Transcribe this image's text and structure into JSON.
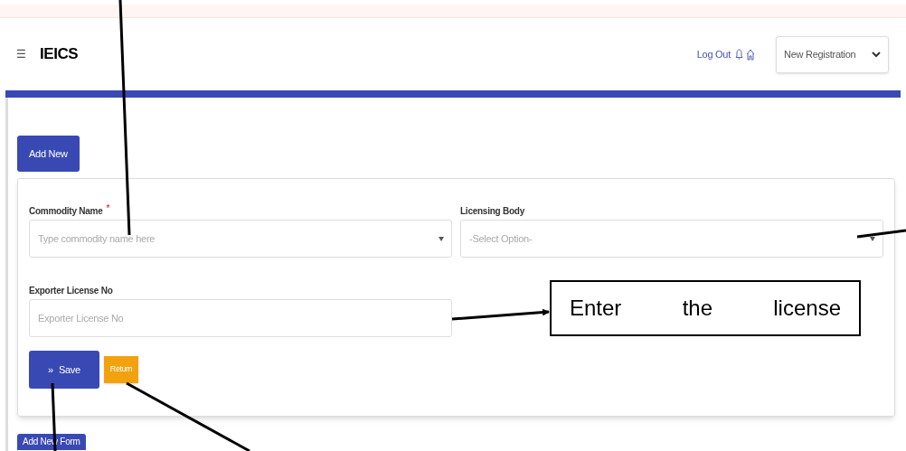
{
  "header": {
    "menu_glyph": "☰",
    "app_title": "IEICS",
    "logout_link": "Log Out",
    "registration_select": {
      "value": "New Registration"
    }
  },
  "add_new_button": "Add New",
  "form": {
    "fields": [
      {
        "label": "Commodity Name",
        "required_mark": "*",
        "kind": "combo",
        "placeholder": "Type commodity name here"
      },
      {
        "label": "Licensing Body",
        "kind": "select",
        "placeholder": "-Select Option-"
      },
      {
        "label": "Exporter License No",
        "kind": "text",
        "placeholder": "Exporter License No"
      }
    ],
    "save_button": {
      "glyph": "»",
      "label": "Save"
    },
    "return_button": "Return"
  },
  "add_new_form_button": "Add New Form",
  "callout": "Enter the license"
}
